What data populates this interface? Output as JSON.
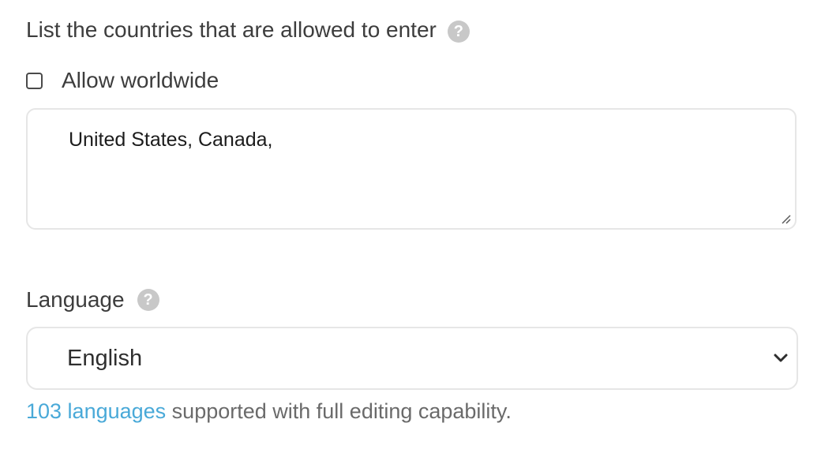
{
  "countries": {
    "label": "List the countries that are allowed to enter",
    "help_icon": "question-mark-icon",
    "allow_worldwide": {
      "label": "Allow worldwide",
      "checked": false
    },
    "value": "United States, Canada,"
  },
  "language": {
    "label": "Language",
    "help_icon": "question-mark-icon",
    "selected": "English",
    "chevron_icon": "chevron-down-icon"
  },
  "footer": {
    "link_text": "103 languages",
    "rest_text": " supported with full editing capability."
  },
  "colors": {
    "link": "#49a9d8",
    "help_icon_bg": "#c8c8c8",
    "field_border": "#e6e6e6"
  }
}
